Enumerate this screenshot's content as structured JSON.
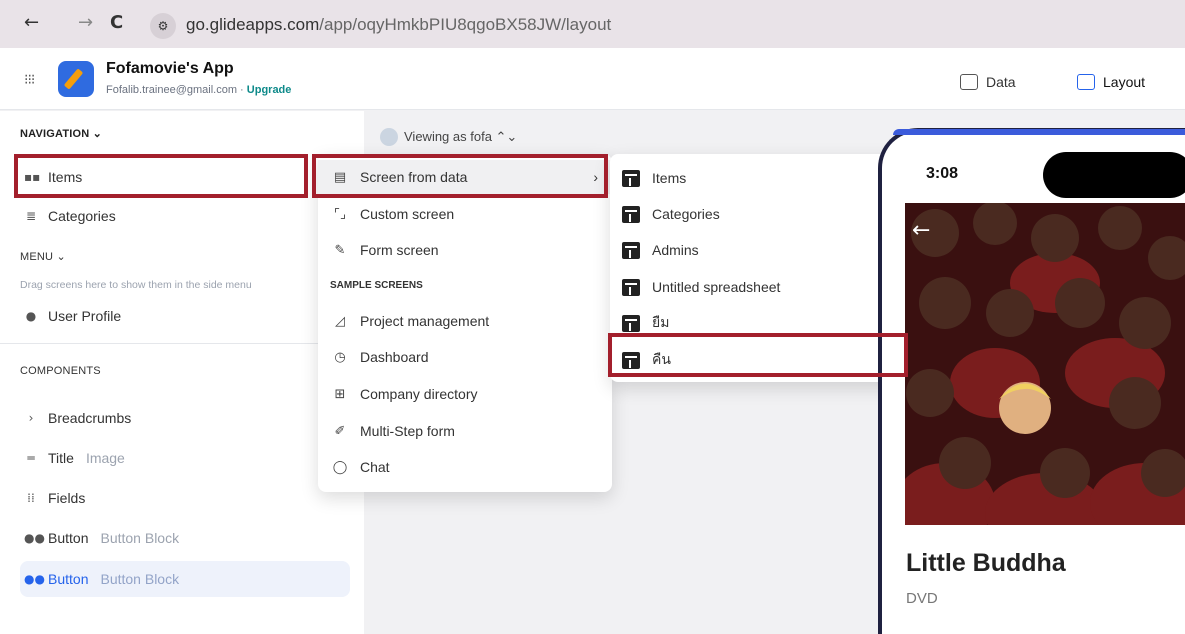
{
  "browser": {
    "url_domain": "go.glideapps.com",
    "url_path": "/app/oqyHmkbPIU8qgoBX58JW/layout",
    "site_info_icon": "tune-icon"
  },
  "app": {
    "name": "Fofamovie's App",
    "email": "Fofalib.trainee@gmail.com",
    "separator": " · ",
    "upgrade_label": "Upgrade"
  },
  "tabs": {
    "data_label": "Data",
    "layout_label": "Layout"
  },
  "sidebar": {
    "navigation_heading": "NAVIGATION ⌄",
    "nav_items": [
      {
        "label": "Items",
        "icon": "grid-icon"
      },
      {
        "label": "Categories",
        "icon": "list-icon"
      }
    ],
    "menu_heading": "MENU ⌄",
    "drag_hint": "Drag screens here to show them in the side menu",
    "menu_items": [
      {
        "label": "User Profile",
        "icon": "user-icon"
      }
    ],
    "components_heading": "COMPONENTS",
    "components": [
      {
        "label": "Breadcrumbs",
        "secondary": "",
        "icon": "chevron-right-icon"
      },
      {
        "label": "Title",
        "secondary": "Image",
        "icon": "title-icon"
      },
      {
        "label": "Fields",
        "secondary": "",
        "icon": "fields-icon"
      },
      {
        "label": "Button",
        "secondary": "Button Block",
        "icon": "button-icon"
      },
      {
        "label": "Button",
        "secondary": "Button Block",
        "icon": "button-icon"
      }
    ]
  },
  "viewing_as": "Viewing as fofa ⌃⌄",
  "add_menu": {
    "items": [
      {
        "label": "Screen from data",
        "icon": "table-icon"
      },
      {
        "label": "Custom screen",
        "icon": "dashed-square-icon"
      },
      {
        "label": "Form screen",
        "icon": "pencil-icon"
      }
    ],
    "sample_heading": "SAMPLE SCREENS",
    "samples": [
      {
        "label": "Project management",
        "icon": "triangle-icon"
      },
      {
        "label": "Dashboard",
        "icon": "clock-icon"
      },
      {
        "label": "Company directory",
        "icon": "directory-icon"
      },
      {
        "label": "Multi-Step form",
        "icon": "edit-icon"
      },
      {
        "label": "Chat",
        "icon": "chat-icon"
      }
    ]
  },
  "data_submenu": {
    "items": [
      "Items",
      "Categories",
      "Admins",
      "Untitled spreadsheet",
      "ยืม",
      "คืน"
    ]
  },
  "preview": {
    "time": "3:08",
    "title": "Little Buddha",
    "subtitle": "DVD"
  },
  "colors": {
    "highlight_box": "#a31f2c",
    "accent": "#2563eb",
    "upgrade": "#0e8a8a"
  }
}
